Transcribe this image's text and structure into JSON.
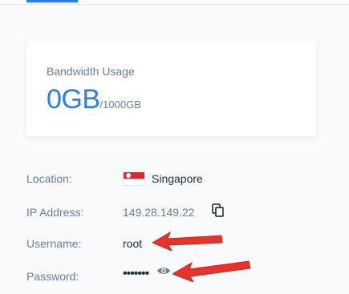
{
  "bandwidth": {
    "title": "Bandwidth Usage",
    "used": "0GB",
    "total": "/1000GB"
  },
  "info": {
    "location_label": "Location:",
    "location_value": "Singapore",
    "location_flag_icon": "singapore-flag-icon",
    "ip_label": "IP Address:",
    "ip_value": "149.28.149.22",
    "ip_action_icon": "copy-icon",
    "username_label": "Username:",
    "username_value": "root",
    "password_label": "Password:",
    "password_value": "•••••••",
    "password_action_icon": "eye-icon"
  },
  "colors": {
    "accent": "#2b7de9",
    "annotation_arrow": "#e8322e",
    "label_text": "#6b7e93"
  }
}
